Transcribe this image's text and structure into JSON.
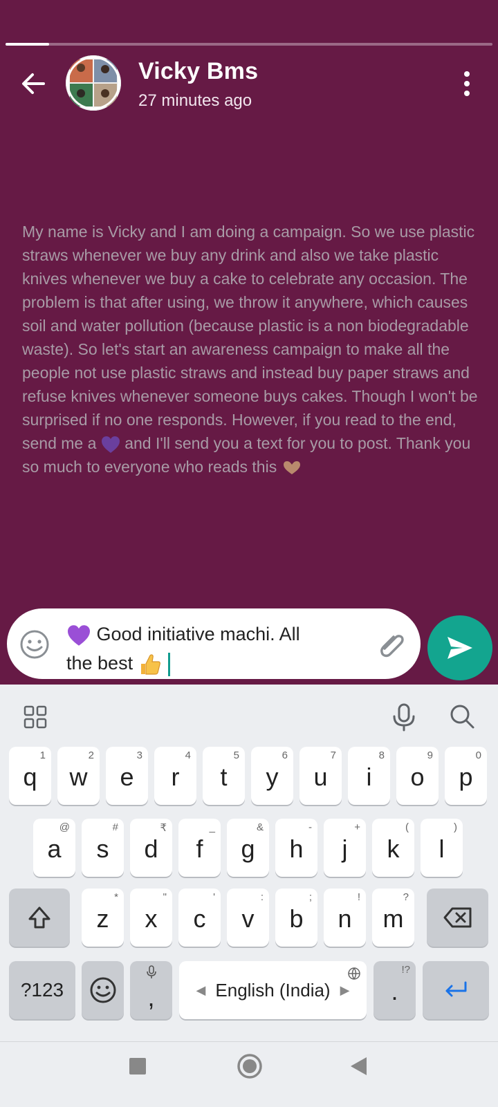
{
  "header": {
    "name": "Vicky Bms",
    "time": "27 minutes ago",
    "progress": 0.09
  },
  "status": {
    "text_before_heart": "My name is Vicky and I am doing a campaign. So we use plastic straws whenever we buy any drink and also we take plastic knives whenever we buy a cake to celebrate any occasion. The problem is that after using, we throw it anywhere, which causes soil and water pollution (because plastic is a non biodegradable waste). So let's start an awareness campaign to make all the people not use plastic straws and instead buy paper straws and refuse knives whenever someone buys cakes. Though I won't be surprised if no one responds. However, if you read to the end, send me a",
    "text_after_heart": "and I'll send you a text for you to post. Thank you so much to everyone who reads this"
  },
  "reply": {
    "text1": "Good initiative machi. All",
    "text2": "the best"
  },
  "keyboard": {
    "row1": [
      {
        "k": "q",
        "h": "1"
      },
      {
        "k": "w",
        "h": "2"
      },
      {
        "k": "e",
        "h": "3"
      },
      {
        "k": "r",
        "h": "4"
      },
      {
        "k": "t",
        "h": "5"
      },
      {
        "k": "y",
        "h": "6"
      },
      {
        "k": "u",
        "h": "7"
      },
      {
        "k": "i",
        "h": "8"
      },
      {
        "k": "o",
        "h": "9"
      },
      {
        "k": "p",
        "h": "0"
      }
    ],
    "row2": [
      {
        "k": "a",
        "h": "@"
      },
      {
        "k": "s",
        "h": "#"
      },
      {
        "k": "d",
        "h": "₹"
      },
      {
        "k": "f",
        "h": "_"
      },
      {
        "k": "g",
        "h": "&"
      },
      {
        "k": "h",
        "h": "-"
      },
      {
        "k": "j",
        "h": "+"
      },
      {
        "k": "k",
        "h": "("
      },
      {
        "k": "l",
        "h": ")"
      }
    ],
    "row3": [
      {
        "k": "z",
        "h": "*"
      },
      {
        "k": "x",
        "h": "\""
      },
      {
        "k": "c",
        "h": "'"
      },
      {
        "k": "v",
        "h": ":"
      },
      {
        "k": "b",
        "h": ";"
      },
      {
        "k": "n",
        "h": "!"
      },
      {
        "k": "m",
        "h": "?"
      }
    ],
    "symbols_label": "?123",
    "comma": ",",
    "period": ".",
    "period_hint": "!?",
    "space_label": "English (India)"
  },
  "colors": {
    "status_bg": "#661a45",
    "send": "#13a58f",
    "enter": "#1a73e8"
  }
}
